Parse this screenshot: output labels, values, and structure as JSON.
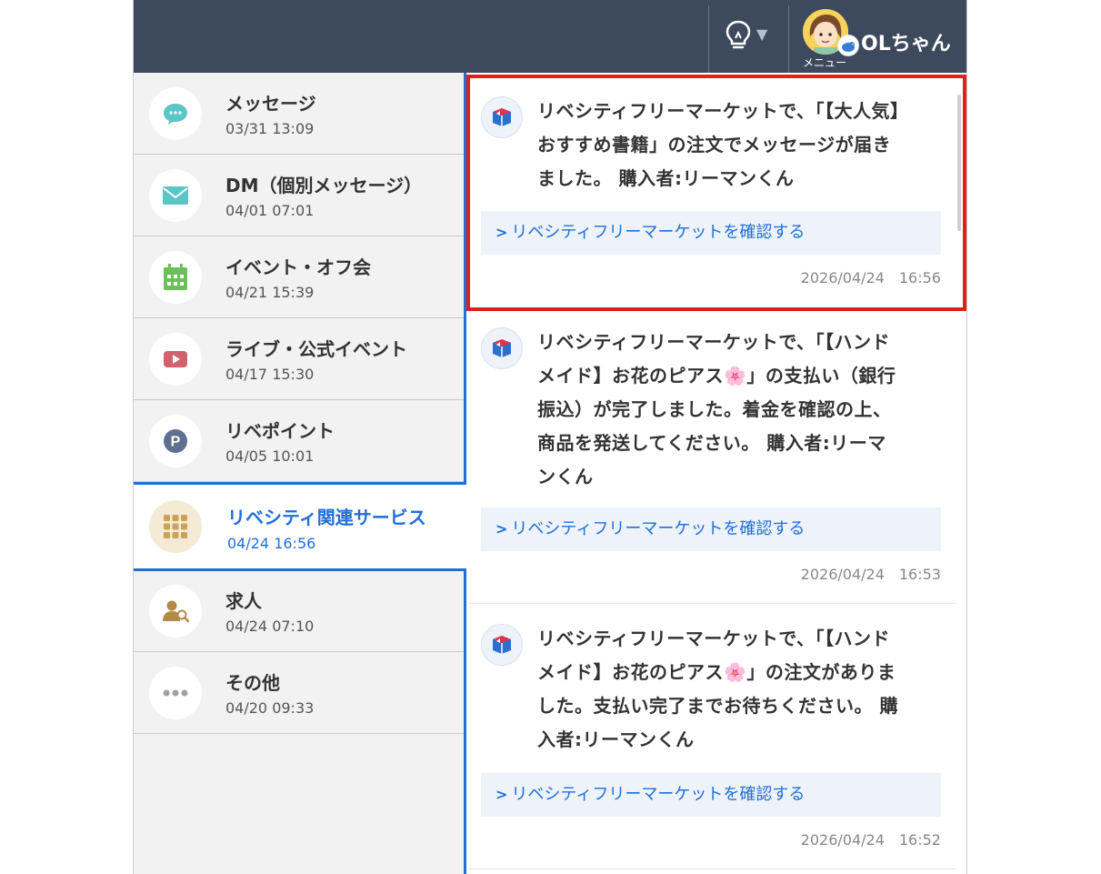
{
  "header": {
    "user_name": "OLちゃん",
    "menu_label": "メニュー"
  },
  "sidebar": {
    "items": [
      {
        "title": "メッセージ",
        "date": "03/31 13:09",
        "icon": "chat-bubble-icon"
      },
      {
        "title": "DM（個別メッセージ）",
        "date": "04/01 07:01",
        "icon": "envelope-icon"
      },
      {
        "title": "イベント・オフ会",
        "date": "04/21 15:39",
        "icon": "calendar-icon"
      },
      {
        "title": "ライブ・公式イベント",
        "date": "04/17 15:30",
        "icon": "play-video-icon"
      },
      {
        "title": "リベポイント",
        "date": "04/05 10:01",
        "icon": "point-p-icon"
      },
      {
        "title": "リベシティ関連サービス",
        "date": "04/24 16:56",
        "icon": "grid-apps-icon"
      },
      {
        "title": "求人",
        "date": "04/24 07:10",
        "icon": "person-search-icon"
      },
      {
        "title": "その他",
        "date": "04/20 09:33",
        "icon": "more-dots-icon"
      }
    ]
  },
  "notifications": [
    {
      "lines": [
        "リベシティフリーマーケットで、「【大人気】",
        "おすすめ書籍」の注文でメッセージが届き",
        "ました。 購入者:リーマンくん"
      ],
      "link": "リベシティフリーマーケットを確認する",
      "time": "2026/04/24　16:56"
    },
    {
      "lines": [
        "リベシティフリーマーケットで、「【ハンド",
        "メイド】お花のピアス🌸」の支払い（銀行",
        "振込）が完了しました。着金を確認の上、",
        "商品を発送してください。 購入者:リーマ",
        "ンくん"
      ],
      "link": "リベシティフリーマーケットを確認する",
      "time": "2026/04/24　16:53"
    },
    {
      "lines": [
        "リベシティフリーマーケットで、「【ハンド",
        "メイド】お花のピアス🌸」の注文がありま",
        "した。支払い完了までお待ちください。 購",
        "入者:リーマンくん"
      ],
      "link": "リベシティフリーマーケットを確認する",
      "time": "2026/04/24　16:52"
    }
  ],
  "colors": {
    "header_bg": "#3d4a5e",
    "accent_blue": "#1e6fd9",
    "highlight_red": "#e0201b"
  }
}
